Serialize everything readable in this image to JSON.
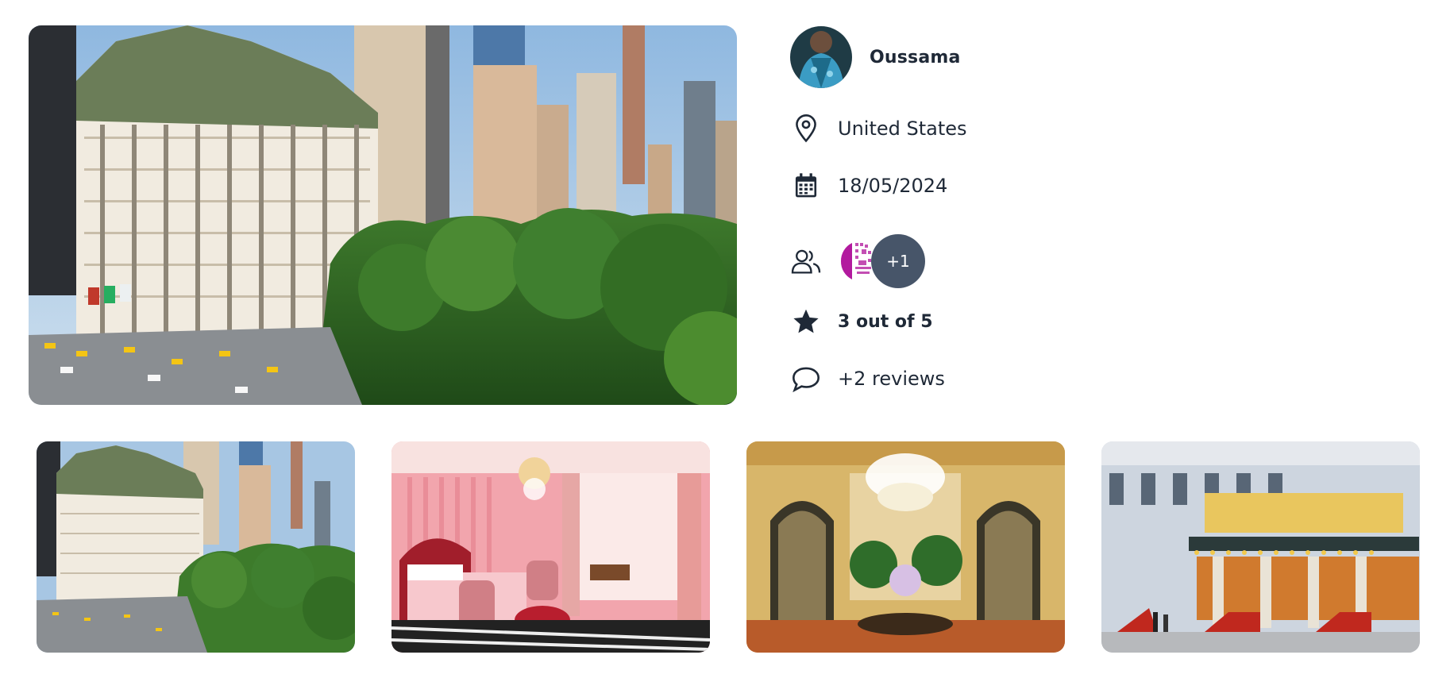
{
  "user": {
    "name": "Oussama",
    "avatar_icon": "user-avatar-photo"
  },
  "details": {
    "location": "United States",
    "date": "18/05/2024",
    "participants_more": "+1",
    "rating": "3 out of 5",
    "reviews": "+2 reviews"
  },
  "icons": {
    "location": "map-pin-icon",
    "date": "calendar-icon",
    "participants": "users-icon",
    "rating": "star-icon",
    "reviews": "chat-bubble-icon"
  },
  "gallery": {
    "main_image": "plaza-hotel-exterior",
    "thumbnails": [
      "plaza-hotel-exterior",
      "pink-bedroom-suite",
      "grand-lobby-chandelier",
      "hotel-entrance-red-stairs"
    ]
  },
  "colors": {
    "text": "#1f2937",
    "more_badge": "#475569"
  }
}
